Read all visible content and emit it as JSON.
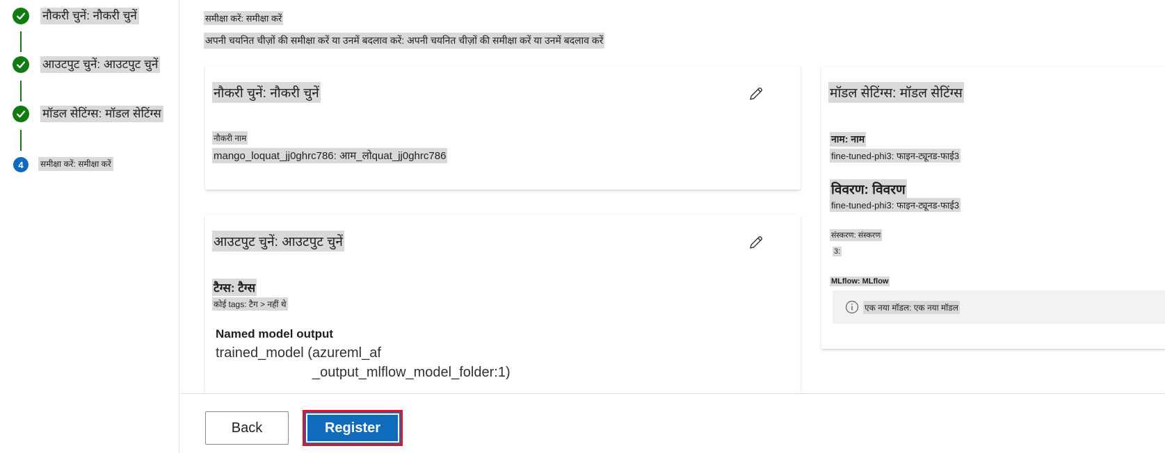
{
  "stepper": {
    "steps": [
      {
        "label": "नौकरी चुनें: नौकरी चुनें",
        "state": "done"
      },
      {
        "label": "आउटपुट चुनें: आउटपुट चुनें",
        "state": "done"
      },
      {
        "label": "मॉडल सेटिंग्स: मॉडल सेटिंग्स",
        "state": "done"
      },
      {
        "label": "समीक्षा करें: समीक्षा करें",
        "state": "current",
        "number": "4"
      }
    ]
  },
  "review": {
    "title": "समीक्षा करें: समीक्षा करें",
    "subtitle": "अपनी चयनित चीज़ों की समीक्षा करें या उनमें बदलाव करें: अपनी चयनित चीज़ों की समीक्षा करें या उनमें बदलाव करें"
  },
  "job_card": {
    "title": "नौकरी चुनें: नौकरी चुनें",
    "job_name_label": "नौकरी नाम",
    "job_name_value": "mango_loquat_jj0ghrc786: आम_लोquat_jj0ghrc786"
  },
  "output_card": {
    "title": "आउटपुट चुनें: आउटपुट चुनें",
    "tags_label": "टैग्स: टैग्स",
    "tags_value": "कोई tags: टैग > नहीं थे",
    "named_output_label": "Named model output",
    "named_output_value_line1": "trained_model (azureml_af",
    "named_output_value_line2": "_output_mlflow_model_folder:1)"
  },
  "model_card": {
    "title": "मॉडल सेटिंग्स: मॉडल सेटिंग्स",
    "name_label": "नाम: नाम",
    "name_value": "fine-tuned-phi3: फाइन-ट्यूनड-फाई3",
    "description_label": "विवरण: विवरण",
    "description_value": "fine-tuned-phi3: फाइन-ट्यूनड-फाई3",
    "version_label": "संस्करण: संस्करण",
    "version_value": "3:",
    "mlflow_label": "MLflow: MLflow",
    "info_text": "एक नया मॉडल: एक नया मॉडल"
  },
  "footer": {
    "back_label": "Back",
    "register_label": "Register"
  },
  "colors": {
    "done": "#107c10",
    "current": "#0f6cbd",
    "primary": "#0f6cbd",
    "highlight_border": "#e81123"
  }
}
